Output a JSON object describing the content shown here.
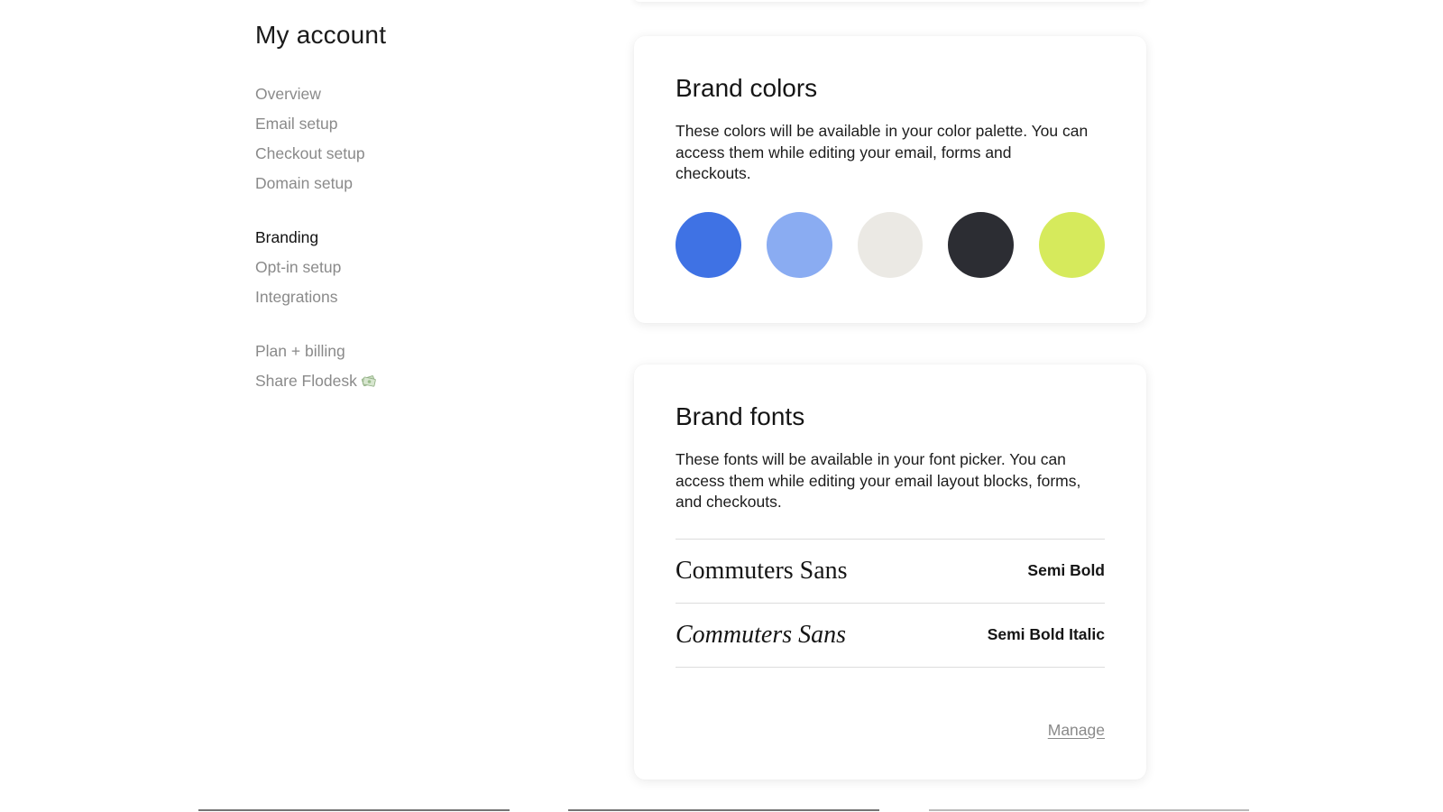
{
  "sidebar": {
    "title": "My account",
    "groups": [
      {
        "items": [
          {
            "label": "Overview",
            "active": false
          },
          {
            "label": "Email setup",
            "active": false
          },
          {
            "label": "Checkout setup",
            "active": false
          },
          {
            "label": "Domain setup",
            "active": false
          }
        ]
      },
      {
        "items": [
          {
            "label": "Branding",
            "active": true
          },
          {
            "label": "Opt-in setup",
            "active": false
          },
          {
            "label": "Integrations",
            "active": false
          }
        ]
      },
      {
        "items": [
          {
            "label": "Plan + billing",
            "active": false
          },
          {
            "label": "Share Flodesk",
            "active": false,
            "icon": "money-icon"
          }
        ]
      }
    ]
  },
  "brand_colors": {
    "title": "Brand colors",
    "description": "These colors will be available in your color palette. You can access them while editing your email, forms and checkouts.",
    "swatches": [
      "#3f72e4",
      "#8aacf2",
      "#ebe9e4",
      "#2c2d33",
      "#d6ea5c"
    ]
  },
  "brand_fonts": {
    "title": "Brand fonts",
    "description": "These fonts will be available in your font picker. You can access them while editing your email layout blocks, forms, and checkouts.",
    "fonts": [
      {
        "name": "Commuters Sans",
        "weight": "Semi Bold",
        "italic": false
      },
      {
        "name": "Commuters Sans",
        "weight": "Semi Bold Italic",
        "italic": true
      }
    ],
    "manage_label": "Manage"
  }
}
